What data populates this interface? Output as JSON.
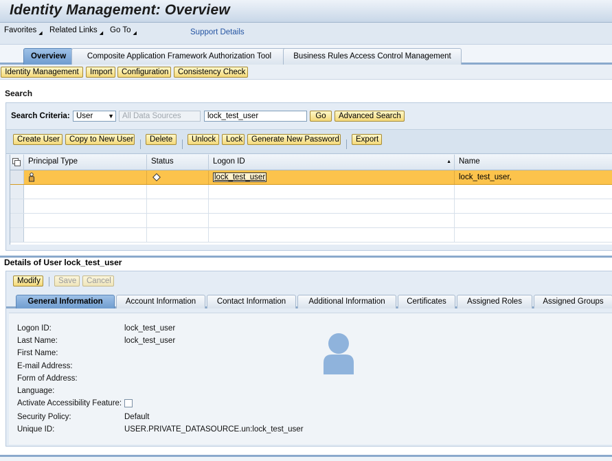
{
  "title": "Identity Management: Overview",
  "menu": {
    "favorites": "Favorites",
    "related_links": "Related Links",
    "go_to": "Go To",
    "support_details": "Support Details",
    "arrow": "◢"
  },
  "top_tabs": [
    {
      "label": "Overview"
    },
    {
      "label": "Composite Application Framework Authorization Tool"
    },
    {
      "label": "Business Rules Access Control Management"
    }
  ],
  "sub_nav": [
    {
      "label": "Identity Management"
    },
    {
      "label": "Import"
    },
    {
      "label": "Configuration"
    },
    {
      "label": "Consistency Check"
    }
  ],
  "search": {
    "section_title": "Search",
    "criteria_label": "Search Criteria:",
    "principal_type": "User",
    "data_source": "All Data Sources",
    "query": "lock_test_user",
    "go": "Go",
    "advanced": "Advanced Search"
  },
  "toolbar": {
    "create_user": "Create User",
    "copy_to_new_user": "Copy to New User",
    "delete": "Delete",
    "unlock": "Unlock",
    "lock": "Lock",
    "generate_password": "Generate New Password",
    "export": "Export"
  },
  "table": {
    "columns": [
      "Principal Type",
      "Status",
      "Logon ID",
      "Name"
    ],
    "sort_indicator": "▲",
    "rows": [
      {
        "principal_type_icon": "user-icon",
        "status_icon": "diamond-status-icon",
        "logon_id": "lock_test_user",
        "name": "lock_test_user,"
      }
    ],
    "empty_rows": 4
  },
  "details": {
    "title": "Details of User lock_test_user",
    "buttons": {
      "modify": "Modify",
      "save": "Save",
      "cancel": "Cancel"
    },
    "tabs": [
      {
        "label": "General Information"
      },
      {
        "label": "Account Information"
      },
      {
        "label": "Contact Information"
      },
      {
        "label": "Additional Information"
      },
      {
        "label": "Certificates"
      },
      {
        "label": "Assigned Roles"
      },
      {
        "label": "Assigned Groups"
      }
    ],
    "fields": {
      "logon_id": {
        "label": "Logon ID:",
        "value": "lock_test_user"
      },
      "last_name": {
        "label": "Last Name:",
        "value": "lock_test_user"
      },
      "first_name": {
        "label": "First Name:",
        "value": ""
      },
      "email": {
        "label": "E-mail Address:",
        "value": ""
      },
      "form_of_address": {
        "label": "Form of Address:",
        "value": ""
      },
      "language": {
        "label": "Language:",
        "value": ""
      },
      "accessibility": {
        "label": "Activate Accessibility Feature:",
        "checked": false
      },
      "security_policy": {
        "label": "Security Policy:",
        "value": "Default"
      },
      "unique_id": {
        "label": "Unique ID:",
        "value": "USER.PRIVATE_DATASOURCE.un:lock_test_user"
      }
    },
    "avatar_icon": "user-silhouette-icon"
  },
  "colors": {
    "selected_row": "#fcc34c",
    "button_yellow": "#f4d97a",
    "active_tab": "#6f9ccf",
    "link": "#2454a2"
  }
}
